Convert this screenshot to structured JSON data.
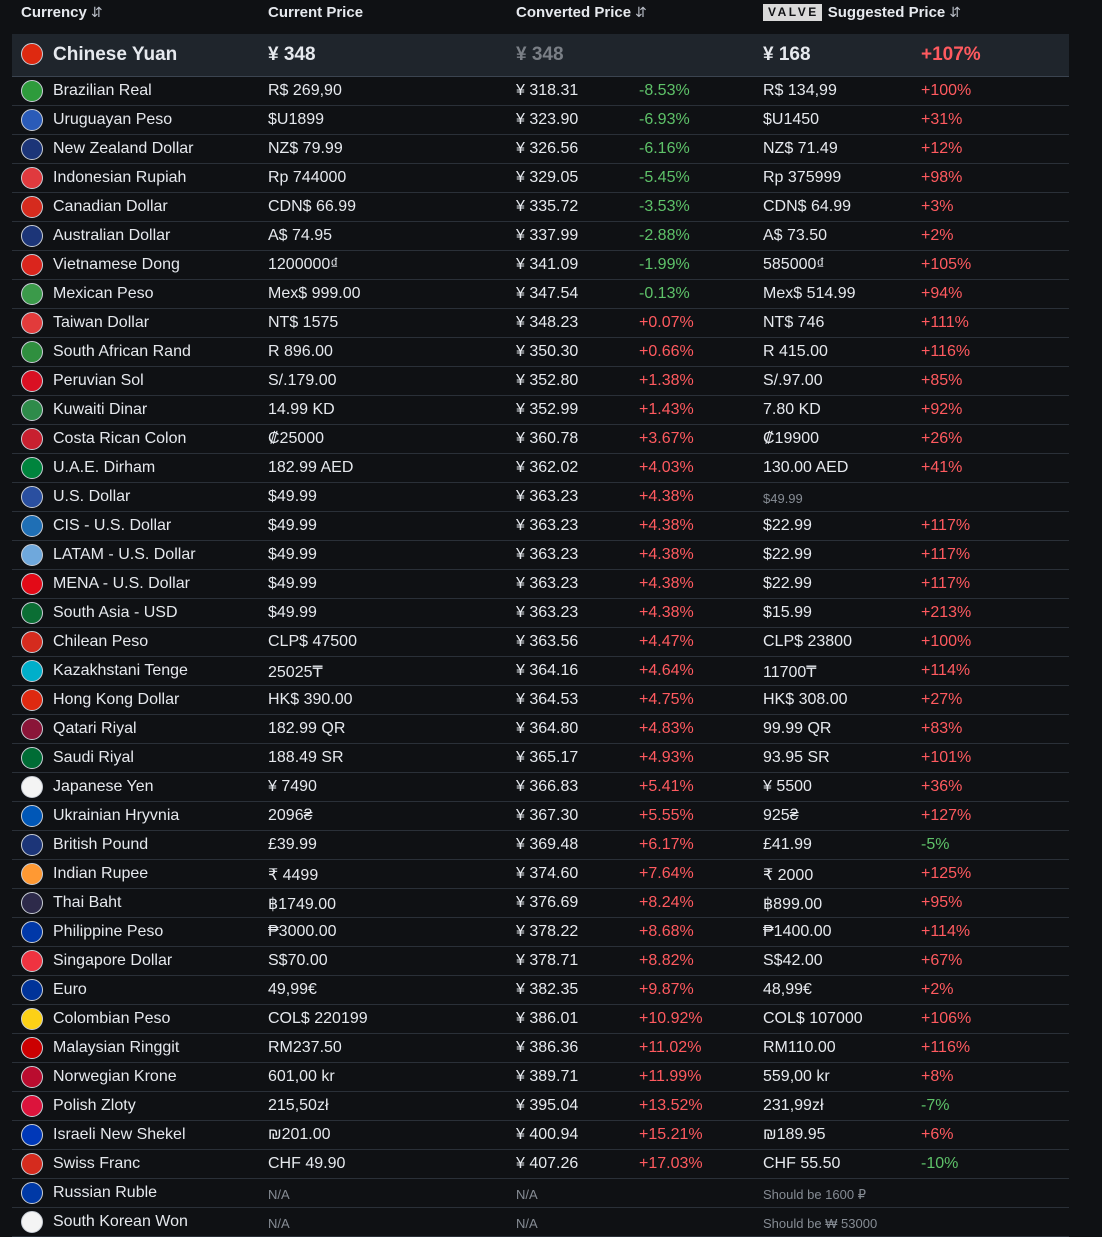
{
  "header": {
    "currency": "Currency",
    "current_price": "Current Price",
    "converted_price": "Converted Price",
    "valve_badge": "VALVE",
    "suggested_price": "Suggested Price",
    "sort_icon": "⇵"
  },
  "base": {
    "name": "Chinese Yuan",
    "current": "¥ 348",
    "converted": "¥ 348",
    "suggested": "¥ 168",
    "suggested_diff": "+107%",
    "flag": "#de2910"
  },
  "rows": [
    {
      "name": "Brazilian Real",
      "current": "R$ 269,90",
      "converted": "¥ 318.31",
      "diff": "-8.53%",
      "suggested": "R$ 134,99",
      "sdiff": "+100%",
      "flag": "#2e9b3c"
    },
    {
      "name": "Uruguayan Peso",
      "current": "$U1899",
      "converted": "¥ 323.90",
      "diff": "-6.93%",
      "suggested": "$U1450",
      "sdiff": "+31%",
      "flag": "#2a5bb8"
    },
    {
      "name": "New Zealand Dollar",
      "current": "NZ$ 79.99",
      "converted": "¥ 326.56",
      "diff": "-6.16%",
      "suggested": "NZ$ 71.49",
      "sdiff": "+12%",
      "flag": "#1c3578"
    },
    {
      "name": "Indonesian Rupiah",
      "current": "Rp 744000",
      "converted": "¥ 329.05",
      "diff": "-5.45%",
      "suggested": "Rp 375999",
      "sdiff": "+98%",
      "flag": "#e03a3e"
    },
    {
      "name": "Canadian Dollar",
      "current": "CDN$ 66.99",
      "converted": "¥ 335.72",
      "diff": "-3.53%",
      "suggested": "CDN$ 64.99",
      "sdiff": "+3%",
      "flag": "#d52b1e"
    },
    {
      "name": "Australian Dollar",
      "current": "A$ 74.95",
      "converted": "¥ 337.99",
      "diff": "-2.88%",
      "suggested": "A$ 73.50",
      "sdiff": "+2%",
      "flag": "#1c3578"
    },
    {
      "name": "Vietnamese Dong",
      "current": "1200000₫",
      "converted": "¥ 341.09",
      "diff": "-1.99%",
      "suggested": "585000₫",
      "sdiff": "+105%",
      "flag": "#da251d"
    },
    {
      "name": "Mexican Peso",
      "current": "Mex$ 999.00",
      "converted": "¥ 347.54",
      "diff": "-0.13%",
      "suggested": "Mex$ 514.99",
      "sdiff": "+94%",
      "flag": "#3b9a4a"
    },
    {
      "name": "Taiwan Dollar",
      "current": "NT$ 1575",
      "converted": "¥ 348.23",
      "diff": "+0.07%",
      "suggested": "NT$ 746",
      "sdiff": "+111%",
      "flag": "#e23b3b"
    },
    {
      "name": "South African Rand",
      "current": "R 896.00",
      "converted": "¥ 350.30",
      "diff": "+0.66%",
      "suggested": "R 415.00",
      "sdiff": "+116%",
      "flag": "#2f8f3f"
    },
    {
      "name": "Peruvian Sol",
      "current": "S/.179.00",
      "converted": "¥ 352.80",
      "diff": "+1.38%",
      "suggested": "S/.97.00",
      "sdiff": "+85%",
      "flag": "#d91023"
    },
    {
      "name": "Kuwaiti Dinar",
      "current": "14.99 KD",
      "converted": "¥ 352.99",
      "diff": "+1.43%",
      "suggested": "7.80 KD",
      "sdiff": "+92%",
      "flag": "#2e8b4a"
    },
    {
      "name": "Costa Rican Colon",
      "current": "₡25000",
      "converted": "¥ 360.78",
      "diff": "+3.67%",
      "suggested": "₡19900",
      "sdiff": "+26%",
      "flag": "#c8202f"
    },
    {
      "name": "U.A.E. Dirham",
      "current": "182.99 AED",
      "converted": "¥ 362.02",
      "diff": "+4.03%",
      "suggested": "130.00 AED",
      "sdiff": "+41%",
      "flag": "#00843d"
    },
    {
      "name": "U.S. Dollar",
      "current": "$49.99",
      "converted": "¥ 363.23",
      "diff": "+4.38%",
      "suggested": "$49.99",
      "sdiff": "",
      "suggested_dim": true,
      "flag": "#2a4fa0"
    },
    {
      "name": "CIS - U.S. Dollar",
      "current": "$49.99",
      "converted": "¥ 363.23",
      "diff": "+4.38%",
      "suggested": "$22.99",
      "sdiff": "+117%",
      "flag": "#1f6fb5"
    },
    {
      "name": "LATAM - U.S. Dollar",
      "current": "$49.99",
      "converted": "¥ 363.23",
      "diff": "+4.38%",
      "suggested": "$22.99",
      "sdiff": "+117%",
      "flag": "#6fa8dc"
    },
    {
      "name": "MENA - U.S. Dollar",
      "current": "$49.99",
      "converted": "¥ 363.23",
      "diff": "+4.38%",
      "suggested": "$22.99",
      "sdiff": "+117%",
      "flag": "#e30a17"
    },
    {
      "name": "South Asia - USD",
      "current": "$49.99",
      "converted": "¥ 363.23",
      "diff": "+4.38%",
      "suggested": "$15.99",
      "sdiff": "+213%",
      "flag": "#0b6e34"
    },
    {
      "name": "Chilean Peso",
      "current": "CLP$ 47500",
      "converted": "¥ 363.56",
      "diff": "+4.47%",
      "suggested": "CLP$ 23800",
      "sdiff": "+100%",
      "flag": "#d52b1e"
    },
    {
      "name": "Kazakhstani Tenge",
      "current": "25025₸",
      "converted": "¥ 364.16",
      "diff": "+4.64%",
      "suggested": "11700₸",
      "sdiff": "+114%",
      "flag": "#00afca"
    },
    {
      "name": "Hong Kong Dollar",
      "current": "HK$ 390.00",
      "converted": "¥ 364.53",
      "diff": "+4.75%",
      "suggested": "HK$ 308.00",
      "sdiff": "+27%",
      "flag": "#de2910"
    },
    {
      "name": "Qatari Riyal",
      "current": "182.99 QR",
      "converted": "¥ 364.80",
      "diff": "+4.83%",
      "suggested": "99.99 QR",
      "sdiff": "+83%",
      "flag": "#8a1538"
    },
    {
      "name": "Saudi Riyal",
      "current": "188.49 SR",
      "converted": "¥ 365.17",
      "diff": "+4.93%",
      "suggested": "93.95 SR",
      "sdiff": "+101%",
      "flag": "#006c35"
    },
    {
      "name": "Japanese Yen",
      "current": "¥ 7490",
      "converted": "¥ 366.83",
      "diff": "+5.41%",
      "suggested": "¥ 5500",
      "sdiff": "+36%",
      "flag": "#f4f4f4"
    },
    {
      "name": "Ukrainian Hryvnia",
      "current": "2096₴",
      "converted": "¥ 367.30",
      "diff": "+5.55%",
      "suggested": "925₴",
      "sdiff": "+127%",
      "flag": "#0057b7"
    },
    {
      "name": "British Pound",
      "current": "£39.99",
      "converted": "¥ 369.48",
      "diff": "+6.17%",
      "suggested": "£41.99",
      "sdiff": "-5%",
      "flag": "#1c3578"
    },
    {
      "name": "Indian Rupee",
      "current": "₹ 4499",
      "converted": "¥ 374.60",
      "diff": "+7.64%",
      "suggested": "₹ 2000",
      "sdiff": "+125%",
      "flag": "#ff9933"
    },
    {
      "name": "Thai Baht",
      "current": "฿1749.00",
      "converted": "¥ 376.69",
      "diff": "+8.24%",
      "suggested": "฿899.00",
      "sdiff": "+95%",
      "flag": "#2d2a4a"
    },
    {
      "name": "Philippine Peso",
      "current": "₱3000.00",
      "converted": "¥ 378.22",
      "diff": "+8.68%",
      "suggested": "₱1400.00",
      "sdiff": "+114%",
      "flag": "#0038a8"
    },
    {
      "name": "Singapore Dollar",
      "current": "S$70.00",
      "converted": "¥ 378.71",
      "diff": "+8.82%",
      "suggested": "S$42.00",
      "sdiff": "+67%",
      "flag": "#ef3340"
    },
    {
      "name": "Euro",
      "current": "49,99€",
      "converted": "¥ 382.35",
      "diff": "+9.87%",
      "suggested": "48,99€",
      "sdiff": "+2%",
      "flag": "#003399"
    },
    {
      "name": "Colombian Peso",
      "current": "COL$ 220199",
      "converted": "¥ 386.01",
      "diff": "+10.92%",
      "suggested": "COL$ 107000",
      "sdiff": "+106%",
      "flag": "#fcd116"
    },
    {
      "name": "Malaysian Ringgit",
      "current": "RM237.50",
      "converted": "¥ 386.36",
      "diff": "+11.02%",
      "suggested": "RM110.00",
      "sdiff": "+116%",
      "flag": "#cc0001"
    },
    {
      "name": "Norwegian Krone",
      "current": "601,00 kr",
      "converted": "¥ 389.71",
      "diff": "+11.99%",
      "suggested": "559,00 kr",
      "sdiff": "+8%",
      "flag": "#ba0c2f"
    },
    {
      "name": "Polish Zloty",
      "current": "215,50zł",
      "converted": "¥ 395.04",
      "diff": "+13.52%",
      "suggested": "231,99zł",
      "sdiff": "-7%",
      "flag": "#dc143c"
    },
    {
      "name": "Israeli New Shekel",
      "current": "₪201.00",
      "converted": "¥ 400.94",
      "diff": "+15.21%",
      "suggested": "₪189.95",
      "sdiff": "+6%",
      "flag": "#0038b8"
    },
    {
      "name": "Swiss Franc",
      "current": "CHF 49.90",
      "converted": "¥ 407.26",
      "diff": "+17.03%",
      "suggested": "CHF 55.50",
      "sdiff": "-10%",
      "flag": "#d52b1e"
    },
    {
      "name": "Russian Ruble",
      "current": "N/A",
      "converted": "N/A",
      "diff": "",
      "suggested": "Should be 1600 ₽",
      "sdiff": "",
      "na": true,
      "flag": "#0039a6"
    },
    {
      "name": "South Korean Won",
      "current": "N/A",
      "converted": "N/A",
      "diff": "",
      "suggested": "Should be ₩ 53000",
      "sdiff": "",
      "na": true,
      "flag": "#f4f4f4"
    }
  ]
}
